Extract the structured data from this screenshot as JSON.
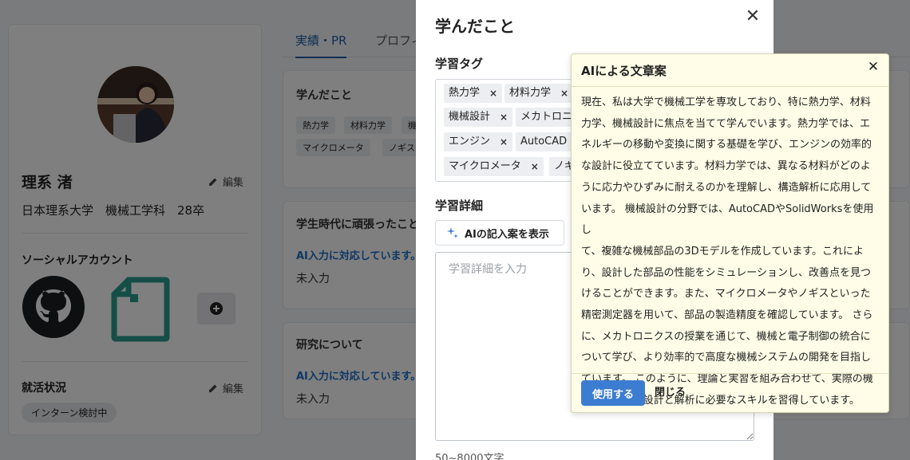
{
  "profile": {
    "name": "理系 渚",
    "edit_label": "編集",
    "university": "日本理系大学　機械工学科　28卒",
    "social_title": "ソーシャルアカウント",
    "job_title": "就活状況",
    "job_edit_label": "編集",
    "job_status": "インターン検討中"
  },
  "tabs": [
    {
      "label": "実績・PR"
    },
    {
      "label": "プロフィ"
    }
  ],
  "sections": {
    "learned": {
      "title": "学んだこと",
      "tags": [
        "熱力学",
        "材料力学",
        "機",
        "マイクロメータ",
        "ノギス"
      ]
    },
    "student_life": {
      "title": "学生時代に頑張ったこと",
      "ai_note": "AI入力に対応しています。",
      "value": "未入力"
    },
    "research": {
      "title": "研究について",
      "ai_note": "AI入力に対応しています。",
      "value": "未入力"
    }
  },
  "modal": {
    "title": "学んだこと",
    "close_glyph": "✕",
    "tags_label": "学習タグ",
    "tags": [
      {
        "label": "熱力学"
      },
      {
        "label": "材料力学"
      },
      {
        "label": "機械設計"
      },
      {
        "label": "メカトロニ"
      },
      {
        "label": "エンジン"
      },
      {
        "label": "AutoCAD"
      },
      {
        "label": "マイクロメータ"
      },
      {
        "label": "ノギ"
      }
    ],
    "tag_remove_glyph": "×",
    "detail_label": "学習詳細",
    "ai_button_label": "AIの記入案を表示",
    "textarea_placeholder": "学習詳細を入力",
    "length_hint": "50~8000文字"
  },
  "popup": {
    "title": "AIによる文章案",
    "close_glyph": "✕",
    "lines": [
      "現在、私は大学で機械工学を専攻しており、特に熱力学、材料",
      "力学、機械設計に焦点を当てて学んでいます。熱力学では、エ",
      "ネルギーの移動や変換に関する基礎を学び、エンジンの効率的",
      "な設計に役立てています。材料力学では、異なる材料がどのよ",
      "うに応力やひずみに耐えるのかを理解し、構造解析に応用して",
      "います。 機械設計の分野では、AutoCADやSolidWorksを使用し",
      "て、複雑な機械部品の3Dモデルを作成しています。これによ",
      "り、設計した部品の性能をシミュレーションし、改善点を見つ",
      "けることができます。また、マイクロメータやノギスといった",
      "精密測定器を用いて、部品の製造精度を確認しています。 さら",
      "に、メカトロニクスの授業を通じて、機械と電子制御の統合に",
      "ついて学び、より効率的で高度な機械システムの開発を目指し",
      "ています。 このように、理論と実習を組み合わせて、実際の機",
      "械システムの設計と解析に必要なスキルを習得しています。"
    ],
    "use_label": "使用する",
    "close_label": "閉じる"
  },
  "colors": {
    "accent": "#3c7dd1",
    "link_blue": "#1f6fc8",
    "popup_bg": "#fffde7",
    "overlay": "rgba(0,0,0,0.5)"
  },
  "icons": {
    "edit": "pencil-icon",
    "github": "github-icon",
    "note": "note-icon",
    "add": "plus-circle-icon",
    "sparkle": "sparkle-icon",
    "close": "close-icon"
  }
}
